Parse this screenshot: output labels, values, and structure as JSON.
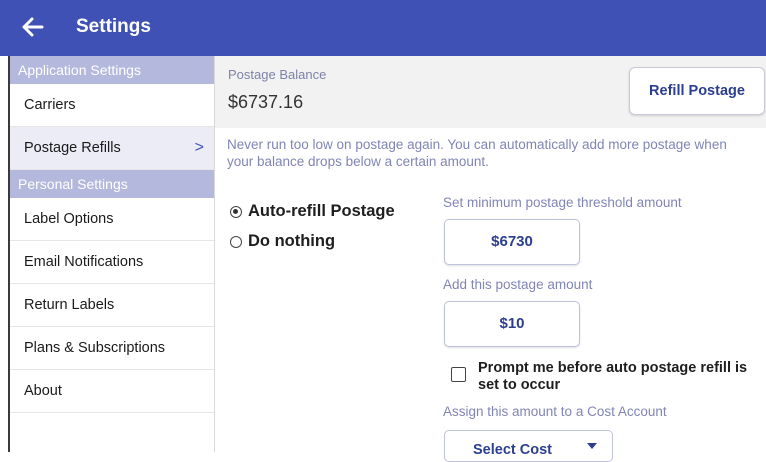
{
  "header": {
    "title": "Settings"
  },
  "sidebar": {
    "sections": [
      {
        "title": "Application Settings",
        "items": [
          {
            "label": "Carriers"
          },
          {
            "label": "Postage Refills",
            "chevron": ">"
          }
        ]
      },
      {
        "title": "Personal Settings",
        "items": [
          {
            "label": "Label Options"
          },
          {
            "label": "Email Notifications"
          },
          {
            "label": "Return Labels"
          },
          {
            "label": "Plans & Subscriptions"
          },
          {
            "label": "About"
          }
        ]
      }
    ]
  },
  "balance": {
    "label": "Postage Balance",
    "value": "$6737.16",
    "refill_button": "Refill Postage"
  },
  "description": "Never run too low on postage again. You can automatically add more postage when your balance drops below a certain amount.",
  "options": {
    "auto_refill": "Auto-refill Postage",
    "do_nothing": "Do nothing",
    "selected": "auto_refill"
  },
  "threshold": {
    "label": "Set minimum postage threshold amount",
    "value": "$6730"
  },
  "add_amount": {
    "label": "Add this postage amount",
    "value": "$10"
  },
  "prompt": {
    "label": "Prompt me before auto postage refill is set to occur",
    "checked": false
  },
  "cost_account": {
    "label": "Assign this amount to a Cost Account",
    "select_label": "Select Cost"
  },
  "colors": {
    "header": "#3f51b5",
    "section_header": "#b3b8dc",
    "accent_text": "#2c3e8f",
    "muted_text": "#8085b5"
  },
  "icons": {
    "back": "arrow-left-icon",
    "chevron": "chevron-right-icon",
    "dropdown": "caret-down-icon"
  }
}
